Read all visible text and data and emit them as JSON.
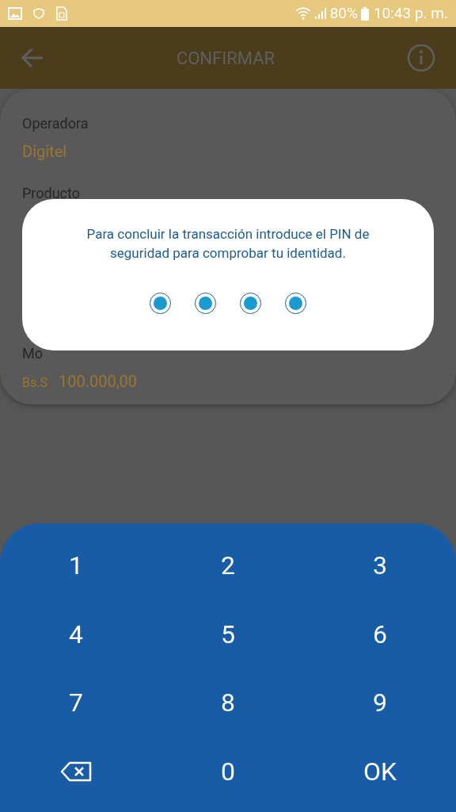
{
  "status_bar": {
    "battery": "80%",
    "time": "10:43 p. m."
  },
  "app_bar": {
    "title": "CONFIRMAR"
  },
  "details": [
    {
      "label": "Operadora",
      "value": "Digitel"
    },
    {
      "label": "Producto"
    },
    {
      "label": "Mo",
      "currency": "Bs.S",
      "value": "100.000,00"
    }
  ],
  "dialog": {
    "message": "Para concluir la transacción introduce el PIN de seguridad para comprobar tu identidad.",
    "pin_dots": [
      {
        "filled": true
      },
      {
        "filled": true
      },
      {
        "filled": true
      },
      {
        "filled": true
      }
    ]
  },
  "keypad": [
    {
      "kind": "digit",
      "label": "1"
    },
    {
      "kind": "digit",
      "label": "2"
    },
    {
      "kind": "digit",
      "label": "3"
    },
    {
      "kind": "digit",
      "label": "4"
    },
    {
      "kind": "digit",
      "label": "5"
    },
    {
      "kind": "digit",
      "label": "6"
    },
    {
      "kind": "digit",
      "label": "7"
    },
    {
      "kind": "digit",
      "label": "8"
    },
    {
      "kind": "digit",
      "label": "9"
    },
    {
      "kind": "backspace"
    },
    {
      "kind": "digit",
      "label": "0"
    },
    {
      "kind": "ok",
      "label": "OK"
    }
  ]
}
